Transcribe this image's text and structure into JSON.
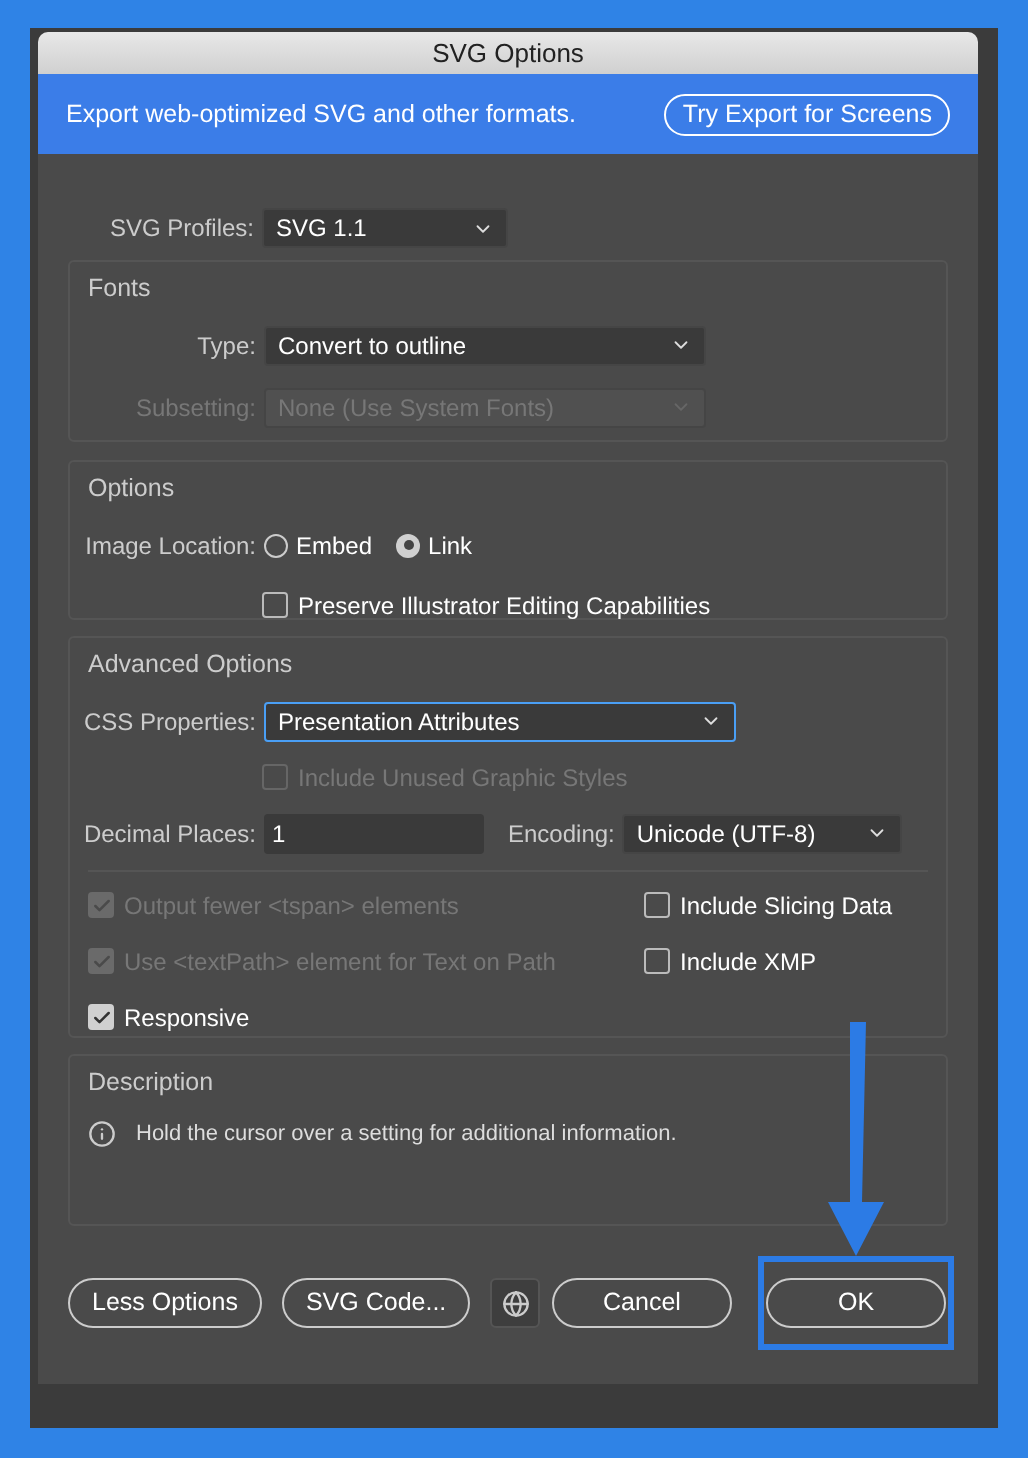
{
  "window": {
    "title": "SVG Options"
  },
  "banner": {
    "text": "Export web-optimized SVG and other formats.",
    "button": "Try Export for Screens"
  },
  "svg_profiles": {
    "label": "SVG Profiles:",
    "value": "SVG 1.1"
  },
  "fonts": {
    "title": "Fonts",
    "type": {
      "label": "Type:",
      "value": "Convert to outline",
      "disabled": false
    },
    "subsetting": {
      "label": "Subsetting:",
      "value": "None (Use System Fonts)",
      "disabled": true
    }
  },
  "options": {
    "title": "Options",
    "image_location": {
      "label": "Image Location:",
      "choices": [
        {
          "label": "Embed",
          "selected": false
        },
        {
          "label": "Link",
          "selected": true
        }
      ]
    },
    "preserve": {
      "label": "Preserve Illustrator Editing Capabilities",
      "checked": false
    }
  },
  "advanced": {
    "title": "Advanced Options",
    "css_properties": {
      "label": "CSS Properties:",
      "value": "Presentation Attributes",
      "focused": true
    },
    "unused_styles": {
      "label": "Include Unused Graphic Styles",
      "checked": false,
      "disabled": true
    },
    "decimal_places": {
      "label": "Decimal Places:",
      "value": "1"
    },
    "encoding": {
      "label": "Encoding:",
      "value": "Unicode (UTF-8)"
    },
    "left_checkboxes": [
      {
        "label": "Output fewer <tspan> elements",
        "checked": true,
        "disabled": true
      },
      {
        "label": "Use <textPath> element for Text on Path",
        "checked": true,
        "disabled": true
      },
      {
        "label": "Responsive",
        "checked": true,
        "disabled": false
      }
    ],
    "right_checkboxes": [
      {
        "label": "Include Slicing Data",
        "checked": false,
        "disabled": false
      },
      {
        "label": "Include XMP",
        "checked": false,
        "disabled": false
      }
    ]
  },
  "description": {
    "title": "Description",
    "text": "Hold the cursor over a setting for additional information."
  },
  "left_buttons": [
    {
      "label": "Less Options"
    },
    {
      "label": "SVG Code..."
    }
  ],
  "right_buttons": [
    {
      "label": "Cancel",
      "highlighted": false
    },
    {
      "label": "OK",
      "highlighted": true
    }
  ]
}
